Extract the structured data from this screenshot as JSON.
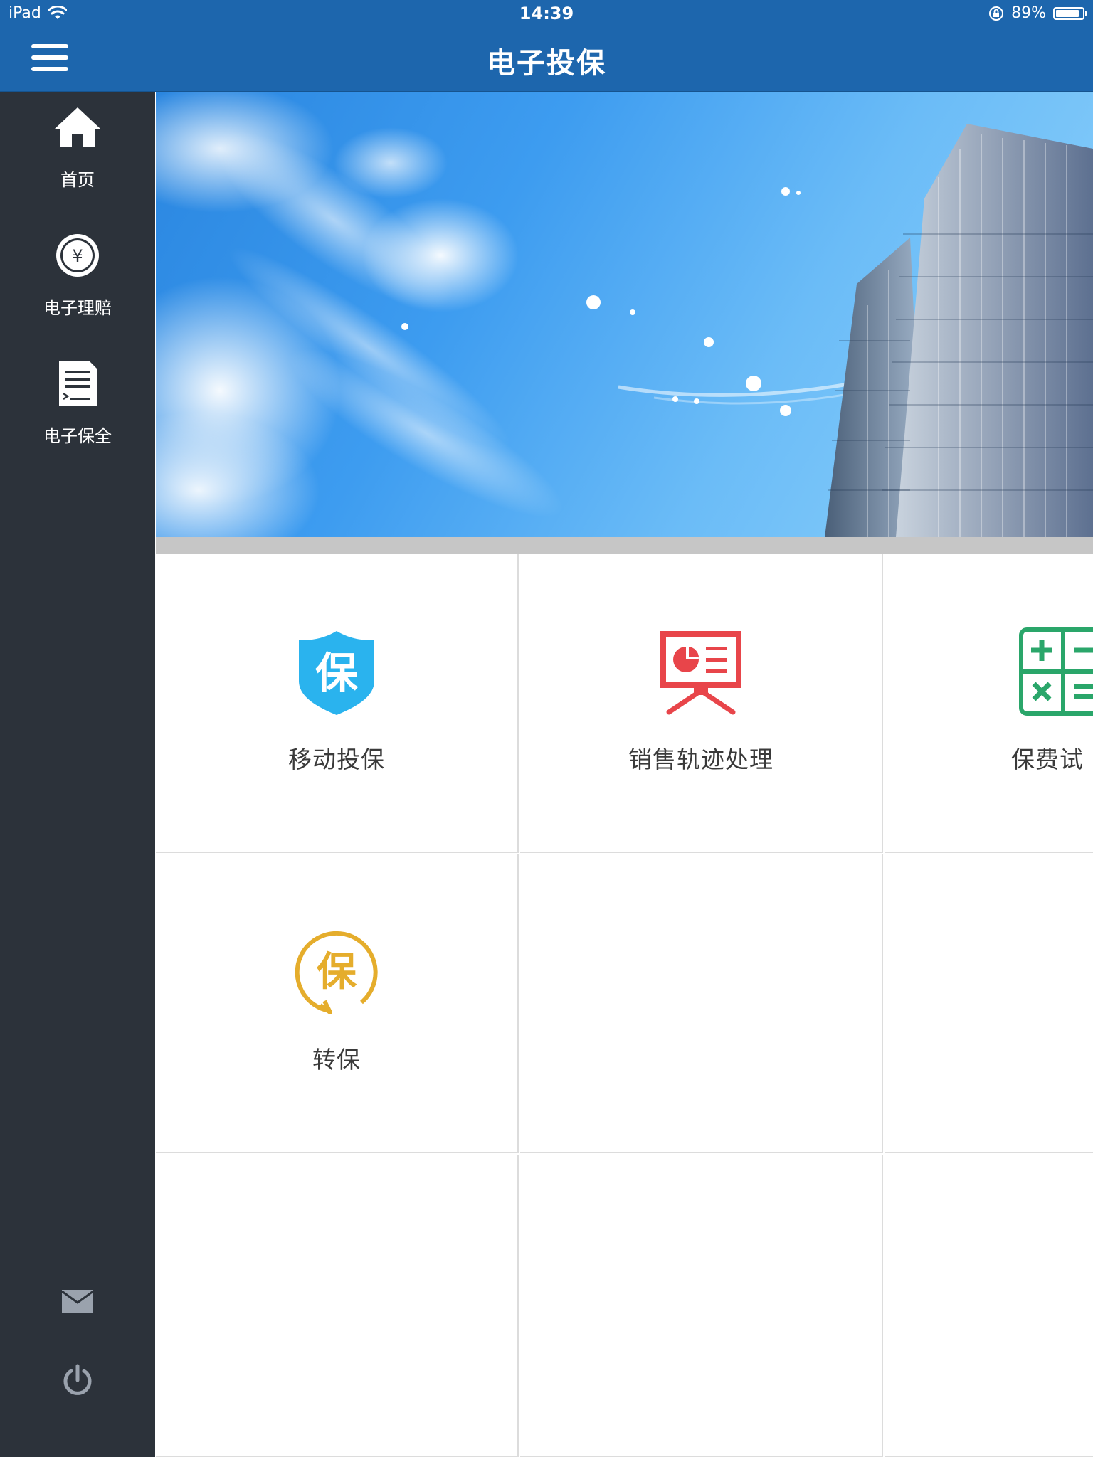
{
  "status_bar": {
    "device": "iPad",
    "time": "14:39",
    "battery": "89%",
    "battery_level": 0.89
  },
  "header": {
    "title": "电子投保"
  },
  "sidebar": {
    "items": [
      {
        "label": "首页",
        "icon": "home-icon"
      },
      {
        "label": "电子理赔",
        "icon": "yen-circle-icon"
      },
      {
        "label": "电子保全",
        "icon": "document-icon"
      }
    ],
    "bottom": [
      {
        "icon": "mail-icon"
      },
      {
        "icon": "power-icon"
      }
    ]
  },
  "banner": {
    "image": "sky-and-skyscrapers"
  },
  "tiles": [
    {
      "label": "移动投保",
      "icon": "shield-bao-icon",
      "color": "#2ab3ee"
    },
    {
      "label": "销售轨迹处理",
      "icon": "presentation-board-icon",
      "color": "#e8454a"
    },
    {
      "label": "保费试",
      "icon": "calculator-icon",
      "color": "#2aa66a"
    },
    {
      "label": "转保",
      "icon": "transfer-bao-icon",
      "color": "#e5ad2c"
    }
  ],
  "colors": {
    "header": "#1d66ad",
    "sidebar": "#2c323a",
    "grid_line": "#dcdcdc"
  }
}
